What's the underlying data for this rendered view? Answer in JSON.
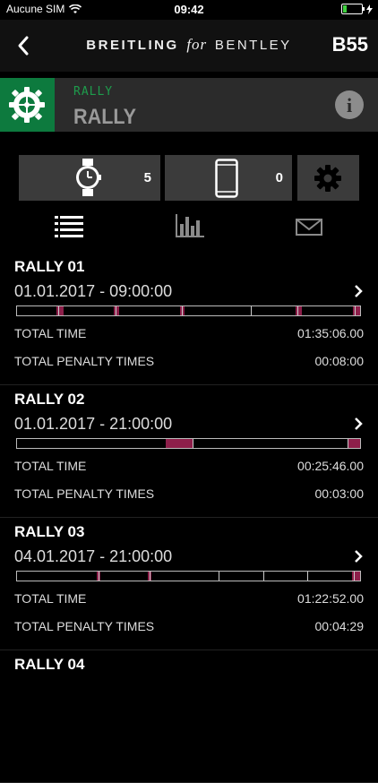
{
  "status": {
    "carrier": "Aucune SIM",
    "time": "09:42"
  },
  "nav": {
    "brand_left": "BREITLING",
    "brand_mid": "for",
    "brand_right": "BENTLEY",
    "model": "B55"
  },
  "rally": {
    "subtitle": "RALLY",
    "title": "RALLY"
  },
  "devices": {
    "watch_count": "5",
    "phone_count": "0"
  },
  "tabs": [
    "list-icon",
    "chart-icon",
    "mail-icon"
  ],
  "labels": {
    "total_time": "TOTAL TIME",
    "penalty": "TOTAL PENALTY TIMES"
  },
  "entries": [
    {
      "title": "RALLY 01",
      "date": "01.01.2017 - 09:00:00",
      "total_time": "01:35:06.00",
      "penalty": "00:08:00"
    },
    {
      "title": "RALLY 02",
      "date": "01.01.2017 - 21:00:00",
      "total_time": "00:25:46.00",
      "penalty": "00:03:00"
    },
    {
      "title": "RALLY 03",
      "date": "04.01.2017 - 21:00:00",
      "total_time": "01:22:52.00",
      "penalty": "00:04:29"
    },
    {
      "title": "RALLY 04",
      "date": "",
      "total_time": "",
      "penalty": ""
    }
  ],
  "colors": {
    "accent_green": "#0d7a3e",
    "penalty": "#8d1f4a"
  }
}
